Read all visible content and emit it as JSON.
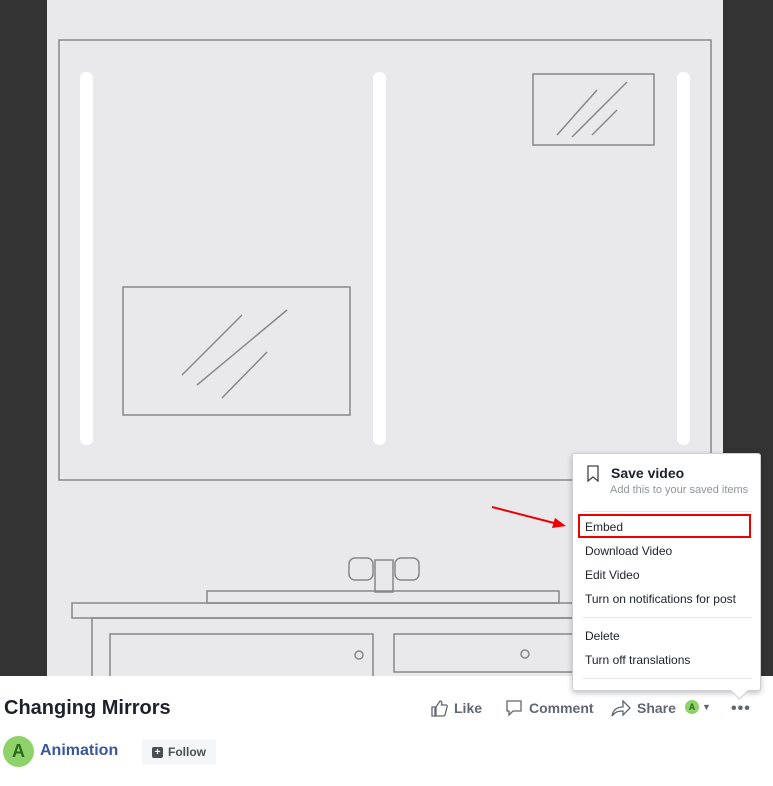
{
  "video": {
    "title": "Changing Mirrors"
  },
  "menu": {
    "save_title": "Save video",
    "save_sub": "Add this to your saved items",
    "items": [
      "Embed",
      "Download Video",
      "Edit Video",
      "Turn on notifications for post",
      "Delete",
      "Turn off translations"
    ]
  },
  "actions": {
    "like": "Like",
    "comment": "Comment",
    "share": "Share",
    "avatar_letter": "A"
  },
  "page": {
    "avatar_letter": "A",
    "name": "Animation",
    "follow": "Follow"
  },
  "colors": {
    "highlight": "#ee0000",
    "link": "#385898",
    "avatar": "#8fd16a"
  }
}
